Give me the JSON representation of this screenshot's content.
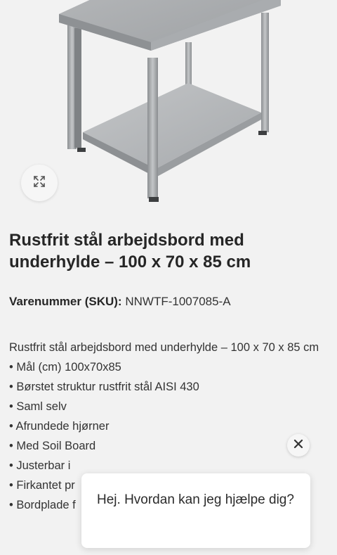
{
  "product": {
    "title": "Rustfrit stål arbejdsbord med underhylde – 100 x 70 x 85 cm",
    "sku_label": "Varenummer (SKU):",
    "sku_value": "NNWTF-1007085-A",
    "description_intro": "Rustfrit stål arbejdsbord med underhylde – 100 x 70 x 85 cm",
    "features": [
      "• Mål (cm) 100x70x85",
      "• Børstet struktur rustfrit stål AISI 430",
      "• Saml selv",
      "• Afrundede hjørner",
      "• Med Soil Board",
      "• Justerbar i",
      "• Firkantet pr",
      "• Bordplade f"
    ]
  },
  "gallery": {
    "zoom_icon": "expand-icon"
  },
  "chat": {
    "message": "Hej. Hvordan kan jeg hjælpe dig?",
    "close_icon": "close-icon"
  },
  "colors": {
    "background": "#f2f2f2",
    "text": "#2b2b2b",
    "chat_bg": "#ffffff"
  }
}
